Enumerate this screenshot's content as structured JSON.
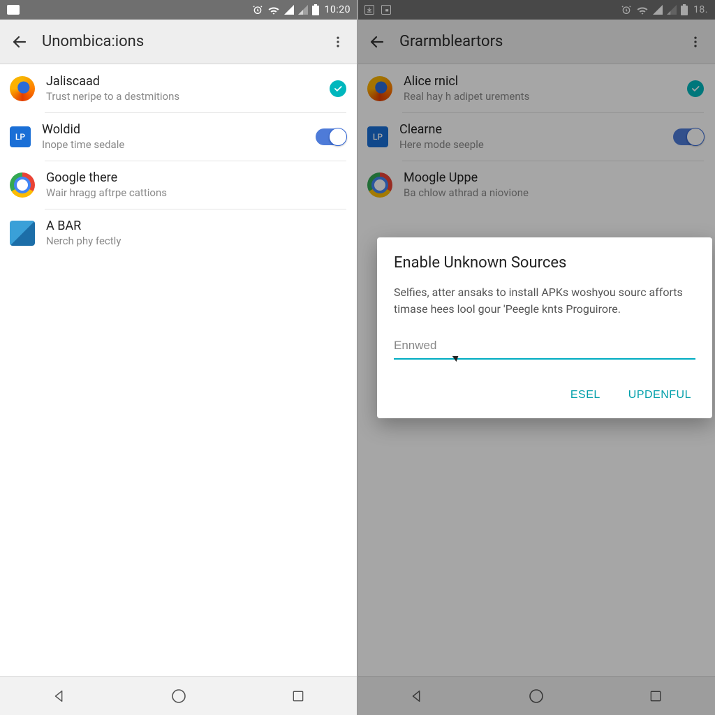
{
  "left": {
    "status": {
      "time": "10:20"
    },
    "appbar": {
      "title": "Unombica:ions"
    },
    "rows": [
      {
        "icon": "firefox",
        "title": "Jaliscaad",
        "sub": "Trust neripe to a destmitions",
        "tail": "check"
      },
      {
        "icon": "bluebox",
        "iconText": "LP",
        "title": "Woldid",
        "sub": "Inope time sedale",
        "tail": "switch"
      },
      {
        "icon": "chrome",
        "title": "Google there",
        "sub": "Wair hragg aftrpe cattions",
        "tail": "none"
      },
      {
        "icon": "box3d",
        "title": "A BAR",
        "sub": "Nerch phy fectly",
        "tail": "none"
      }
    ]
  },
  "right": {
    "status": {
      "time": "18."
    },
    "appbar": {
      "title": "Grarmbleartors"
    },
    "rows": [
      {
        "icon": "firefox",
        "title": "Alice rnicl",
        "sub": "Real hay h adipet urements",
        "tail": "check"
      },
      {
        "icon": "bluebox",
        "iconText": "LP",
        "title": "Clearne",
        "sub": "Here mode seeple",
        "tail": "switch"
      },
      {
        "icon": "chrome",
        "title": "Moogle Uppe",
        "sub": "Ba chlow athrad a niovione",
        "tail": "none"
      }
    ],
    "dialog": {
      "title": "Enable Unknown Sources",
      "body": "Selfies, atter ansaks to install APKs woshyou sourc afforts timase hees lool gour 'Peegle knts Proguirore.",
      "inputValue": "Ennwed",
      "cancelLabel": "ESEL",
      "okLabel": "UPDENFUL"
    }
  },
  "icons": {
    "alarm": "alarm-icon",
    "wifi": "wifi-icon",
    "signal": "signal-icon",
    "battery": "battery-icon",
    "download": "download-icon",
    "pip": "pip-icon"
  }
}
